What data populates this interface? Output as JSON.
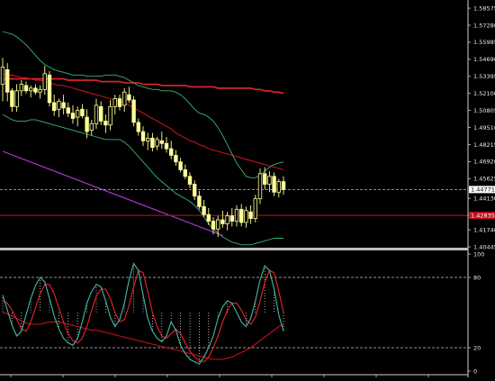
{
  "chart_data": [
    {
      "type": "candlestick",
      "title": "",
      "price_axis_ticks": [
        "1.58575",
        "1.57280",
        "1.55985",
        "1.54690",
        "1.53395",
        "1.52100",
        "1.50805",
        "1.49510",
        "1.48215",
        "1.46920",
        "1.45625",
        "1.44130",
        "1.42835",
        "1.41740",
        "1.40445"
      ],
      "ylim": [
        1.4045,
        1.5858
      ],
      "current_price_label": "1.44771",
      "horizontal_line_label": "1.42835",
      "horizontal_line_value": 1.4284,
      "grid": false,
      "colors": {
        "background": "#000000",
        "candle": "#ffff99",
        "bollinger": "#3cb371",
        "ma_slow": "#e8252a",
        "ma_fast": "#c8101a",
        "trend_line": "#b23bd6",
        "horizontal_line": "#c01020",
        "dashed_line": "#9a9a9a"
      },
      "candles": [
        {
          "o": 1.528,
          "h": 1.548,
          "l": 1.515,
          "c": 1.541
        },
        {
          "o": 1.539,
          "h": 1.544,
          "l": 1.515,
          "c": 1.522
        },
        {
          "o": 1.523,
          "h": 1.525,
          "l": 1.507,
          "c": 1.511
        },
        {
          "o": 1.511,
          "h": 1.528,
          "l": 1.507,
          "c": 1.523
        },
        {
          "o": 1.523,
          "h": 1.531,
          "l": 1.519,
          "c": 1.528
        },
        {
          "o": 1.527,
          "h": 1.53,
          "l": 1.521,
          "c": 1.523
        },
        {
          "o": 1.523,
          "h": 1.527,
          "l": 1.518,
          "c": 1.525
        },
        {
          "o": 1.525,
          "h": 1.528,
          "l": 1.52,
          "c": 1.522
        },
        {
          "o": 1.522,
          "h": 1.527,
          "l": 1.517,
          "c": 1.524
        },
        {
          "o": 1.524,
          "h": 1.542,
          "l": 1.52,
          "c": 1.536
        },
        {
          "o": 1.535,
          "h": 1.538,
          "l": 1.511,
          "c": 1.514
        },
        {
          "o": 1.514,
          "h": 1.52,
          "l": 1.504,
          "c": 1.508
        },
        {
          "o": 1.509,
          "h": 1.517,
          "l": 1.503,
          "c": 1.515
        },
        {
          "o": 1.514,
          "h": 1.52,
          "l": 1.505,
          "c": 1.51
        },
        {
          "o": 1.51,
          "h": 1.514,
          "l": 1.503,
          "c": 1.506
        },
        {
          "o": 1.506,
          "h": 1.512,
          "l": 1.498,
          "c": 1.502
        },
        {
          "o": 1.503,
          "h": 1.511,
          "l": 1.496,
          "c": 1.508
        },
        {
          "o": 1.509,
          "h": 1.513,
          "l": 1.502,
          "c": 1.504
        },
        {
          "o": 1.503,
          "h": 1.509,
          "l": 1.487,
          "c": 1.492
        },
        {
          "o": 1.493,
          "h": 1.501,
          "l": 1.489,
          "c": 1.498
        },
        {
          "o": 1.498,
          "h": 1.517,
          "l": 1.494,
          "c": 1.512
        },
        {
          "o": 1.511,
          "h": 1.515,
          "l": 1.497,
          "c": 1.5
        },
        {
          "o": 1.5,
          "h": 1.505,
          "l": 1.491,
          "c": 1.497
        },
        {
          "o": 1.497,
          "h": 1.516,
          "l": 1.493,
          "c": 1.511
        },
        {
          "o": 1.511,
          "h": 1.52,
          "l": 1.505,
          "c": 1.517
        },
        {
          "o": 1.517,
          "h": 1.52,
          "l": 1.508,
          "c": 1.511
        },
        {
          "o": 1.512,
          "h": 1.525,
          "l": 1.507,
          "c": 1.522
        },
        {
          "o": 1.52,
          "h": 1.526,
          "l": 1.514,
          "c": 1.516
        },
        {
          "o": 1.516,
          "h": 1.519,
          "l": 1.496,
          "c": 1.499
        },
        {
          "o": 1.499,
          "h": 1.502,
          "l": 1.489,
          "c": 1.492
        },
        {
          "o": 1.492,
          "h": 1.496,
          "l": 1.481,
          "c": 1.485
        },
        {
          "o": 1.485,
          "h": 1.491,
          "l": 1.478,
          "c": 1.487
        },
        {
          "o": 1.487,
          "h": 1.491,
          "l": 1.477,
          "c": 1.48
        },
        {
          "o": 1.481,
          "h": 1.488,
          "l": 1.478,
          "c": 1.486
        },
        {
          "o": 1.485,
          "h": 1.492,
          "l": 1.479,
          "c": 1.483
        },
        {
          "o": 1.483,
          "h": 1.488,
          "l": 1.476,
          "c": 1.479
        },
        {
          "o": 1.479,
          "h": 1.485,
          "l": 1.471,
          "c": 1.474
        },
        {
          "o": 1.474,
          "h": 1.478,
          "l": 1.466,
          "c": 1.469
        },
        {
          "o": 1.469,
          "h": 1.472,
          "l": 1.461,
          "c": 1.463
        },
        {
          "o": 1.463,
          "h": 1.467,
          "l": 1.456,
          "c": 1.458
        },
        {
          "o": 1.458,
          "h": 1.461,
          "l": 1.449,
          "c": 1.452
        },
        {
          "o": 1.452,
          "h": 1.455,
          "l": 1.44,
          "c": 1.443
        },
        {
          "o": 1.443,
          "h": 1.447,
          "l": 1.433,
          "c": 1.435
        },
        {
          "o": 1.435,
          "h": 1.44,
          "l": 1.427,
          "c": 1.429
        },
        {
          "o": 1.429,
          "h": 1.434,
          "l": 1.421,
          "c": 1.424
        },
        {
          "o": 1.424,
          "h": 1.427,
          "l": 1.414,
          "c": 1.418
        },
        {
          "o": 1.418,
          "h": 1.428,
          "l": 1.412,
          "c": 1.425
        },
        {
          "o": 1.425,
          "h": 1.432,
          "l": 1.419,
          "c": 1.422
        },
        {
          "o": 1.422,
          "h": 1.431,
          "l": 1.417,
          "c": 1.428
        },
        {
          "o": 1.428,
          "h": 1.434,
          "l": 1.42,
          "c": 1.424
        },
        {
          "o": 1.424,
          "h": 1.436,
          "l": 1.42,
          "c": 1.433
        },
        {
          "o": 1.433,
          "h": 1.437,
          "l": 1.42,
          "c": 1.423
        },
        {
          "o": 1.423,
          "h": 1.435,
          "l": 1.419,
          "c": 1.432
        },
        {
          "o": 1.431,
          "h": 1.436,
          "l": 1.422,
          "c": 1.426
        },
        {
          "o": 1.426,
          "h": 1.444,
          "l": 1.423,
          "c": 1.441
        },
        {
          "o": 1.441,
          "h": 1.464,
          "l": 1.437,
          "c": 1.46
        },
        {
          "o": 1.46,
          "h": 1.465,
          "l": 1.448,
          "c": 1.452
        },
        {
          "o": 1.452,
          "h": 1.462,
          "l": 1.446,
          "c": 1.458
        },
        {
          "o": 1.458,
          "h": 1.461,
          "l": 1.443,
          "c": 1.446
        },
        {
          "o": 1.446,
          "h": 1.456,
          "l": 1.442,
          "c": 1.454
        },
        {
          "o": 1.454,
          "h": 1.458,
          "l": 1.444,
          "c": 1.448
        }
      ],
      "bollinger_upper": [
        1.568,
        1.567,
        1.566,
        1.564,
        1.561,
        1.558,
        1.554,
        1.55,
        1.546,
        1.543,
        1.541,
        1.539,
        1.538,
        1.537,
        1.536,
        1.535,
        1.535,
        1.535,
        1.534,
        1.534,
        1.534,
        1.534,
        1.535,
        1.535,
        1.535,
        1.534,
        1.533,
        1.531,
        1.529,
        1.527,
        1.526,
        1.525,
        1.524,
        1.524,
        1.523,
        1.523,
        1.523,
        1.522,
        1.52,
        1.517,
        1.513,
        1.509,
        1.506,
        1.505,
        1.503,
        1.5,
        1.495,
        1.489,
        1.482,
        1.475,
        1.468,
        1.463,
        1.458,
        1.457,
        1.457,
        1.459,
        1.462,
        1.465,
        1.467,
        1.468,
        1.469
      ],
      "bollinger_lower": [
        1.505,
        1.503,
        1.501,
        1.5,
        1.5,
        1.5,
        1.501,
        1.501,
        1.5,
        1.499,
        1.498,
        1.497,
        1.496,
        1.495,
        1.494,
        1.493,
        1.492,
        1.491,
        1.49,
        1.489,
        1.488,
        1.487,
        1.486,
        1.486,
        1.486,
        1.486,
        1.484,
        1.481,
        1.477,
        1.473,
        1.469,
        1.465,
        1.461,
        1.457,
        1.454,
        1.451,
        1.448,
        1.445,
        1.443,
        1.441,
        1.439,
        1.436,
        1.432,
        1.427,
        1.422,
        1.418,
        1.415,
        1.412,
        1.41,
        1.408,
        1.407,
        1.406,
        1.406,
        1.406,
        1.407,
        1.408,
        1.409,
        1.41,
        1.411,
        1.411,
        1.411
      ],
      "ma_slow": [
        1.532,
        1.532,
        1.532,
        1.532,
        1.532,
        1.532,
        1.532,
        1.532,
        1.532,
        1.532,
        1.532,
        1.532,
        1.532,
        1.532,
        1.531,
        1.531,
        1.531,
        1.531,
        1.531,
        1.531,
        1.531,
        1.53,
        1.53,
        1.53,
        1.53,
        1.53,
        1.529,
        1.529,
        1.529,
        1.529,
        1.528,
        1.528,
        1.528,
        1.528,
        1.527,
        1.527,
        1.527,
        1.527,
        1.527,
        1.527,
        1.526,
        1.526,
        1.526,
        1.526,
        1.526,
        1.526,
        1.525,
        1.525,
        1.525,
        1.525,
        1.525,
        1.525,
        1.525,
        1.525,
        1.524,
        1.524,
        1.523,
        1.523,
        1.522,
        1.522,
        1.521
      ],
      "ma_fast": [
        1.536,
        1.535,
        1.535,
        1.534,
        1.533,
        1.533,
        1.532,
        1.531,
        1.531,
        1.53,
        1.529,
        1.528,
        1.527,
        1.527,
        1.526,
        1.525,
        1.524,
        1.523,
        1.522,
        1.521,
        1.52,
        1.519,
        1.518,
        1.517,
        1.516,
        1.515,
        1.514,
        1.512,
        1.51,
        1.508,
        1.506,
        1.504,
        1.502,
        1.5,
        1.498,
        1.496,
        1.494,
        1.491,
        1.489,
        1.487,
        1.485,
        1.484,
        1.482,
        1.481,
        1.479,
        1.478,
        1.477,
        1.476,
        1.475,
        1.474,
        1.473,
        1.472,
        1.471,
        1.47,
        1.469,
        1.468,
        1.467,
        1.466,
        1.465,
        1.464,
        1.463
      ],
      "trend_line": [
        [
          0,
          1.477
        ],
        [
          47,
          1.413
        ]
      ]
    },
    {
      "type": "line",
      "title": "",
      "y_axis_ticks": [
        "100",
        "80",
        "20",
        "0"
      ],
      "ylim": [
        0,
        100
      ],
      "levels": [
        80,
        20
      ],
      "colors": {
        "main": "#47b8a7",
        "signal": "#e8252a",
        "slow": "#c8101a",
        "level": "#bdbdbd",
        "dots": "#d8d8d8"
      },
      "series": [
        {
          "values": [
            65,
            52,
            39,
            30,
            34,
            48,
            62,
            73,
            80,
            76,
            62,
            47,
            36,
            28,
            24,
            22,
            28,
            42,
            58,
            68,
            74,
            72,
            60,
            46,
            38,
            44,
            58,
            78,
            92,
            86,
            65,
            45,
            34,
            28,
            25,
            30,
            42,
            35,
            22,
            15,
            10,
            8,
            6,
            12,
            20,
            30,
            45,
            55,
            60,
            58,
            50,
            42,
            38,
            45,
            60,
            78,
            90,
            86,
            70,
            48,
            34
          ]
        },
        {
          "values": [
            60,
            58,
            52,
            44,
            36,
            34,
            42,
            54,
            66,
            74,
            74,
            66,
            54,
            42,
            32,
            26,
            24,
            28,
            38,
            52,
            64,
            70,
            70,
            62,
            50,
            42,
            44,
            56,
            72,
            86,
            84,
            68,
            50,
            38,
            30,
            28,
            32,
            36,
            32,
            24,
            17,
            12,
            9,
            8,
            12,
            20,
            30,
            42,
            52,
            58,
            58,
            52,
            44,
            40,
            46,
            60,
            76,
            86,
            84,
            68,
            50
          ]
        },
        {
          "values": [
            50,
            49,
            47,
            45,
            43,
            41,
            40,
            40,
            40,
            41,
            42,
            42,
            42,
            41,
            40,
            39,
            38,
            37,
            36,
            35,
            35,
            34,
            33,
            32,
            31,
            30,
            29,
            28,
            27,
            26,
            25,
            24,
            23,
            22,
            21,
            20,
            19,
            18,
            17,
            16,
            15,
            14,
            13,
            12,
            11,
            10,
            10,
            10,
            11,
            12,
            14,
            16,
            18,
            20,
            23,
            26,
            29,
            32,
            35,
            38,
            40
          ]
        }
      ]
    }
  ]
}
